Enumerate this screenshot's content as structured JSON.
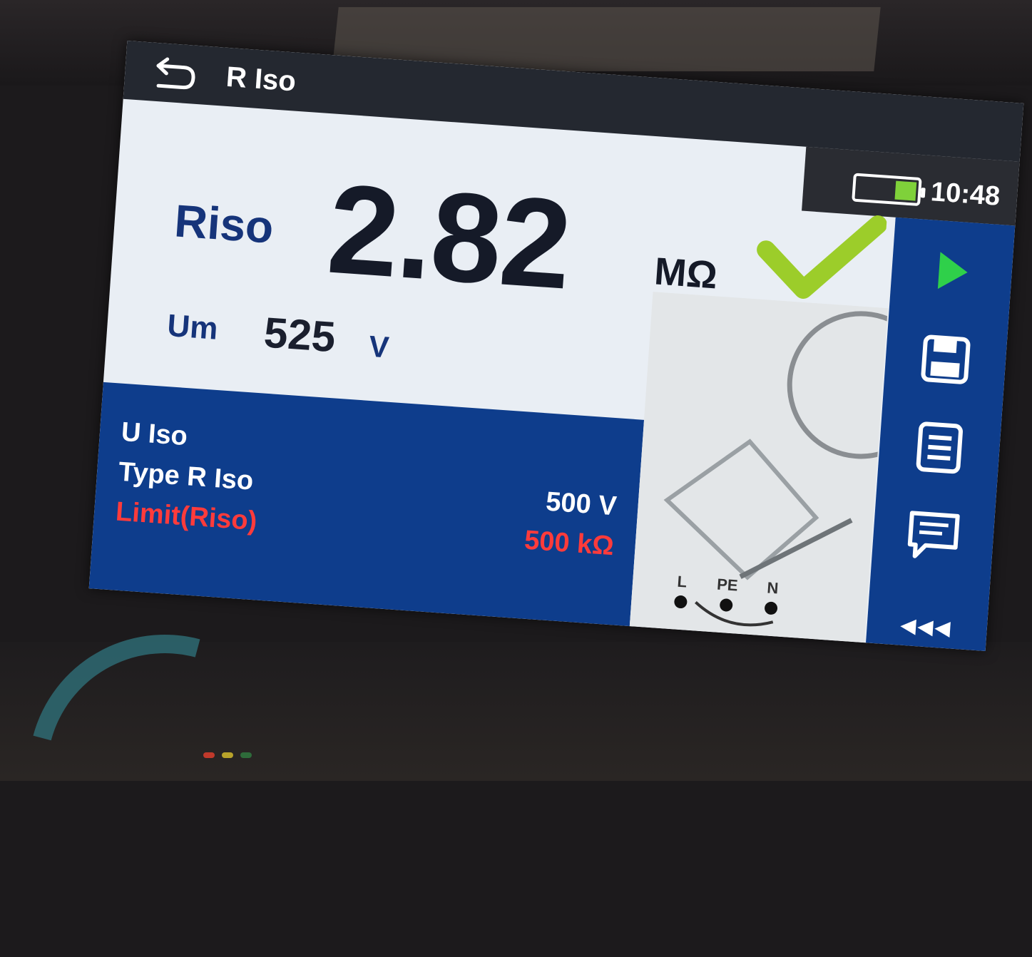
{
  "device": {
    "brand_text": "",
    "title": "R Iso",
    "clock": "10:48",
    "battery_level": 0.35,
    "colors": {
      "accent_blue": "#0e3d8c",
      "pass_green": "#9ccd2a",
      "limit_red": "#ff3b3b",
      "battery_green": "#7fd13a"
    }
  },
  "measurement": {
    "result_label": "Riso",
    "result_value": "2.82",
    "result_unit": "MΩ",
    "status_icon": "check-icon",
    "um_label": "Um",
    "um_value": "525",
    "um_unit": "V"
  },
  "parameters": [
    {
      "name": "U Iso",
      "value": ""
    },
    {
      "name": "Type R Iso",
      "value": "500 V"
    },
    {
      "name": "Limit(Riso)",
      "value": "500 kΩ"
    }
  ],
  "terminals": [
    {
      "label": "L"
    },
    {
      "label": "PE"
    },
    {
      "label": "N"
    }
  ],
  "sidebar": {
    "buttons": [
      {
        "icon": "play-icon"
      },
      {
        "icon": "save-icon"
      },
      {
        "icon": "list-icon"
      },
      {
        "icon": "comment-icon"
      }
    ],
    "collapse_label": "◂◂◂"
  }
}
